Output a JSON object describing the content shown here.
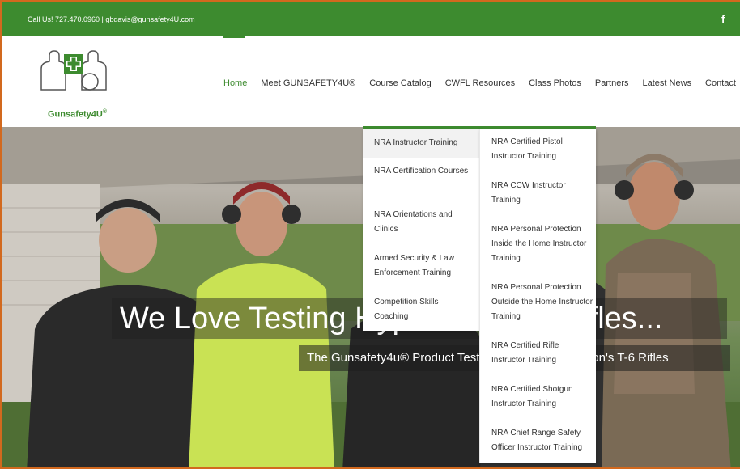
{
  "topbar": {
    "contact": "Call Us! 727.470.0960  |  gbdavis@gunsafety4U.com",
    "facebook_glyph": "f",
    "bg_color": "#3d8b2f"
  },
  "logo": {
    "text": "Gunsafety4U",
    "reg": "®"
  },
  "nav": {
    "items": [
      "Home",
      "Meet GUNSAFETY4U®",
      "Course Catalog",
      "CWFL Resources",
      "Class Photos",
      "Partners",
      "Latest News",
      "Contact"
    ],
    "active": "Home",
    "search_icon": "search-icon",
    "accent_color": "#3d8b2f"
  },
  "hero": {
    "title": "We Love Testing Hyperion's T-6 Rifles...",
    "subtitle": "The Gunsafety4u® Product Testing Team with Hyperion's T-6 Rifles"
  },
  "dropdown": {
    "level1": [
      "NRA Instructor Training",
      "NRA Certification Courses",
      "NRA Orientations and Clinics",
      "Armed Security & Law Enforcement Training",
      "Competition Skills Coaching"
    ],
    "level2": [
      "NRA Certified Pistol Instructor Training",
      "NRA CCW Instructor Training",
      "NRA Personal Protection Inside the Home Instructor Training",
      "NRA Personal Protection Outside the Home Instructor Training",
      "NRA Certified Rifle Instructor Training",
      "NRA Certified Shotgun Instructor Training",
      "NRA Chief Range Safety Officer Instructor Training"
    ]
  }
}
